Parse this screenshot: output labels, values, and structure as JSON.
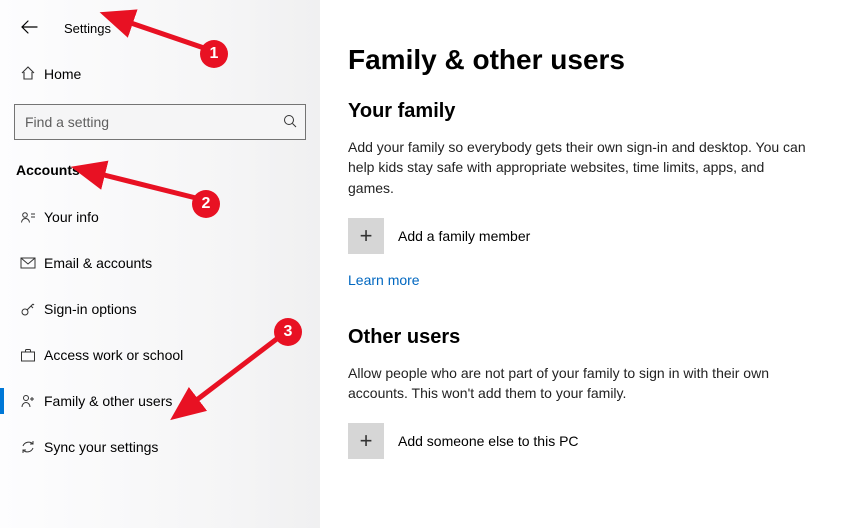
{
  "header": {
    "app_title": "Settings",
    "home_label": "Home"
  },
  "search": {
    "placeholder": "Find a setting"
  },
  "section_label": "Accounts",
  "nav": [
    {
      "label": "Your info"
    },
    {
      "label": "Email & accounts"
    },
    {
      "label": "Sign-in options"
    },
    {
      "label": "Access work or school"
    },
    {
      "label": "Family & other users"
    },
    {
      "label": "Sync your settings"
    }
  ],
  "main": {
    "title": "Family & other users",
    "family_heading": "Your family",
    "family_desc": "Add your family so everybody gets their own sign-in and desktop. You can help kids stay safe with appropriate websites, time limits, apps, and games.",
    "add_family_label": "Add a family member",
    "learn_more": "Learn more",
    "other_heading": "Other users",
    "other_desc": "Allow people who are not part of your family to sign in with their own accounts. This won't add them to your family.",
    "add_other_label": "Add someone else to this PC"
  },
  "annotations": {
    "badge1": "1",
    "badge2": "2",
    "badge3": "3"
  }
}
